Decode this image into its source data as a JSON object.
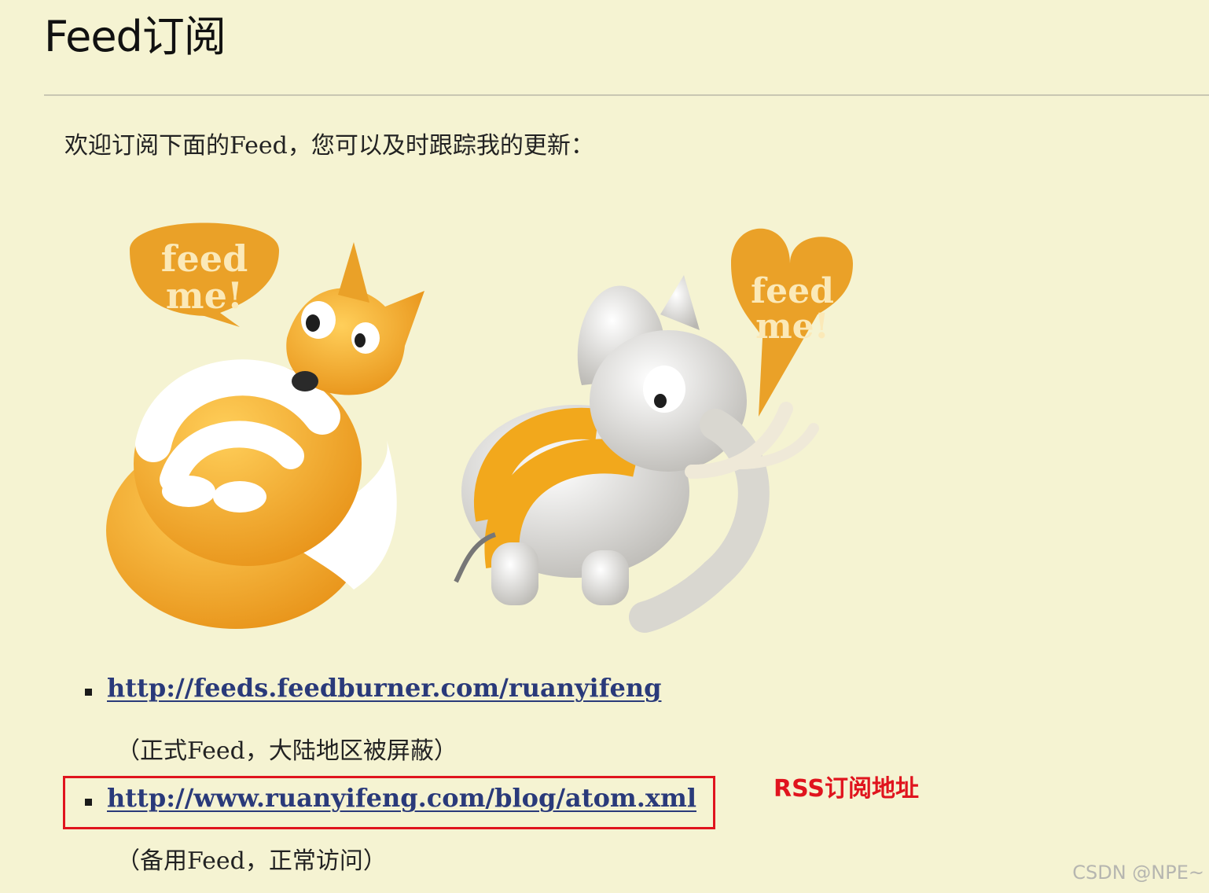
{
  "header": {
    "title": "Feed订阅"
  },
  "intro": "欢迎订阅下面的Feed，您可以及时跟踪我的更新：",
  "illustration": {
    "fox_bubble": {
      "line1": "feed",
      "line2": "me!"
    },
    "elephant_bubble": {
      "line1": "feed",
      "line2": "me!"
    }
  },
  "feeds": [
    {
      "url": "http://feeds.feedburner.com/ruanyifeng",
      "note": "（正式Feed，大陆地区被屏蔽）"
    },
    {
      "url": "http://www.ruanyifeng.com/blog/atom.xml",
      "note": "（备用Feed，正常访问）"
    }
  ],
  "annotation": "RSS订阅地址",
  "watermark": "CSDN @NPE~",
  "colors": {
    "background": "#f5f3d2",
    "link": "#2a3a7a",
    "highlight": "#e0141e",
    "orange": "#f0a020"
  }
}
